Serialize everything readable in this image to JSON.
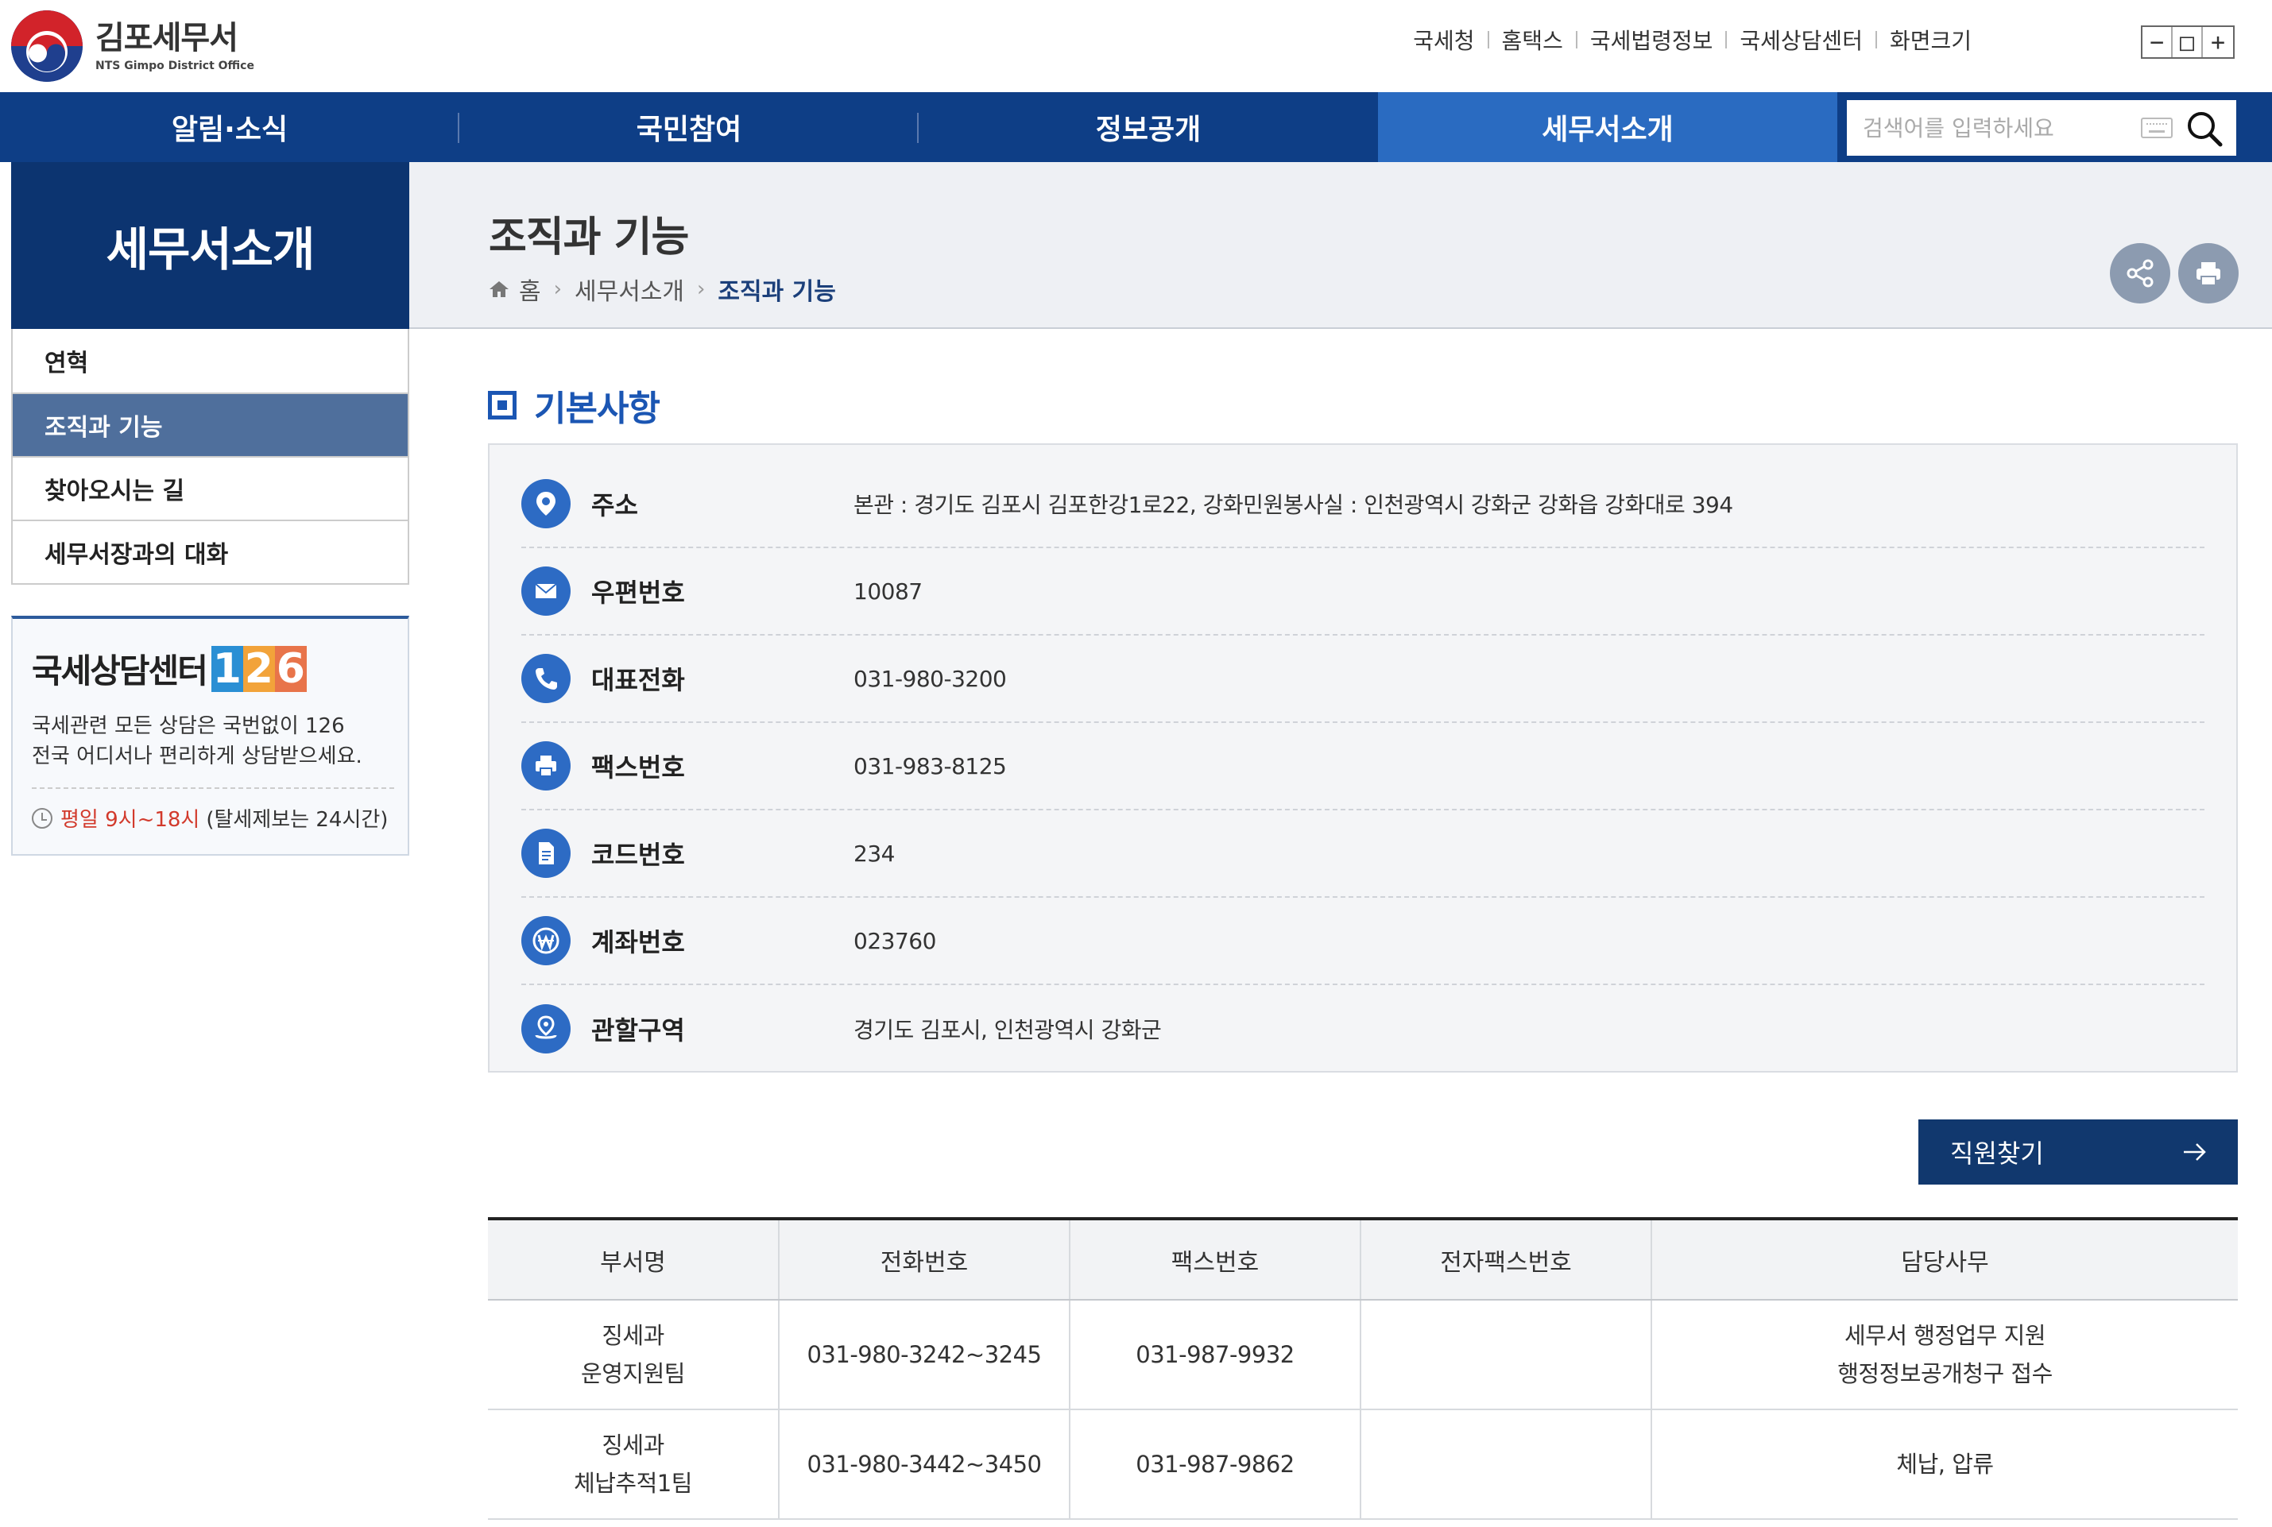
{
  "header": {
    "logo_title": "김포세무서",
    "logo_sub": "NTS Gimpo District Office",
    "util_links": [
      "국세청",
      "홈택스",
      "국세법령정보",
      "국세상담센터"
    ],
    "font_size_label": "화면크기",
    "font_size_buttons": [
      "−",
      "□",
      "+"
    ]
  },
  "nav": {
    "items": [
      "알림·소식",
      "국민참여",
      "정보공개",
      "세무서소개"
    ],
    "active": "세무서소개",
    "search_placeholder": "검색어를 입력하세요"
  },
  "sidebar": {
    "title": "세무서소개",
    "items": [
      "연혁",
      "조직과 기능",
      "찾아오시는 길",
      "세무서장과의 대화"
    ],
    "active": "조직과 기능",
    "consult": {
      "title": "국세상담센터",
      "number_digits": [
        "1",
        "2",
        "6"
      ],
      "desc_line1": "국세관련 모든 상담은 국번없이 126",
      "desc_line2": "전국 어디서나 편리하게 상담받으세요.",
      "time_red": "평일 9시~18시",
      "time_note": "(탈세제보는 24시간)"
    }
  },
  "page": {
    "title": "조직과 기능",
    "breadcrumb": [
      "홈",
      "세무서소개",
      "조직과 기능"
    ]
  },
  "basic_info": {
    "heading": "기본사항",
    "rows": [
      {
        "icon": "location-pin-icon",
        "label": "주소",
        "value": "본관 : 경기도 김포시 김포한강1로22, 강화민원봉사실 : 인천광역시 강화군 강화읍 강화대로 394"
      },
      {
        "icon": "mail-icon",
        "label": "우편번호",
        "value": "10087"
      },
      {
        "icon": "phone-icon",
        "label": "대표전화",
        "value": "031-980-3200"
      },
      {
        "icon": "fax-printer-icon",
        "label": "팩스번호",
        "value": "031-983-8125"
      },
      {
        "icon": "document-icon",
        "label": "코드번호",
        "value": "234"
      },
      {
        "icon": "won-currency-icon",
        "label": "계좌번호",
        "value": "023760"
      },
      {
        "icon": "map-area-icon",
        "label": "관할구역",
        "value": "경기도 김포시, 인천광역시 강화군"
      }
    ]
  },
  "staff_button": "직원찾기",
  "dept_table": {
    "headers": [
      "부서명",
      "전화번호",
      "팩스번호",
      "전자팩스번호",
      "담당사무"
    ],
    "rows": [
      {
        "dept": [
          "징세과",
          "운영지원팀"
        ],
        "phone": "031-980-3242~3245",
        "fax": "031-987-9932",
        "efax": "",
        "duty": [
          "세무서 행정업무 지원",
          "행정정보공개청구 접수"
        ]
      },
      {
        "dept": [
          "징세과",
          "체납추적1팀"
        ],
        "phone": "031-980-3442~3450",
        "fax": "031-987-9862",
        "efax": "",
        "duty": [
          "체납, 압류"
        ]
      }
    ]
  },
  "colors": {
    "nav_bg": "#0e3e86",
    "nav_active": "#2a6bc1",
    "sidebar_head": "#0c3470",
    "sidebar_active": "#4f6f9c",
    "accent_blue": "#1b56b3",
    "icon_blue": "#2d6bc4",
    "staff_btn": "#11386e"
  }
}
